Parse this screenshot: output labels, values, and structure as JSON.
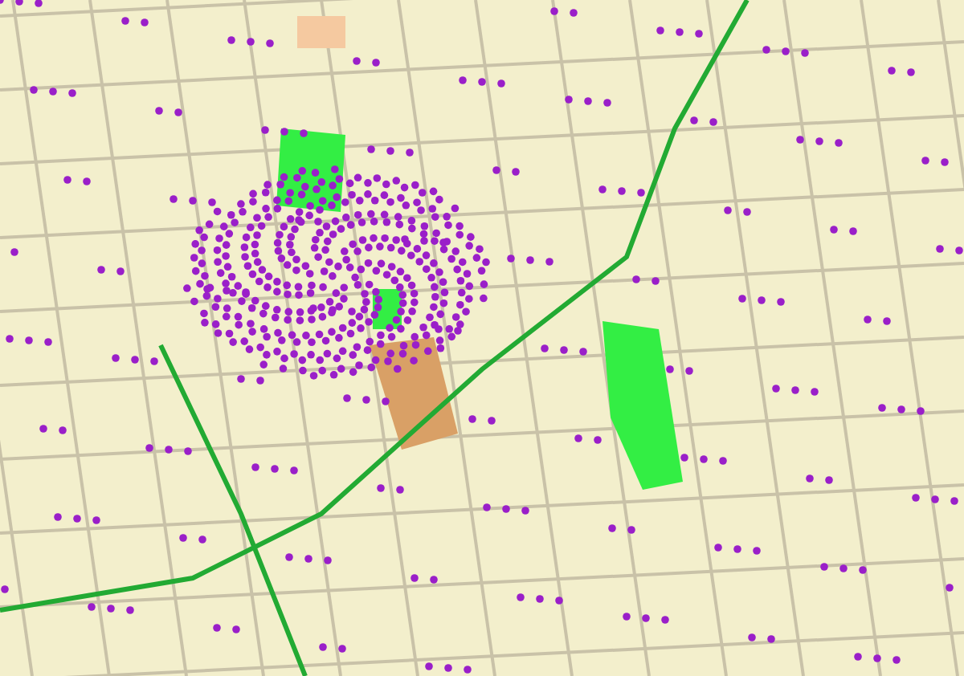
{
  "map": {
    "kind": "street-map"
  }
}
